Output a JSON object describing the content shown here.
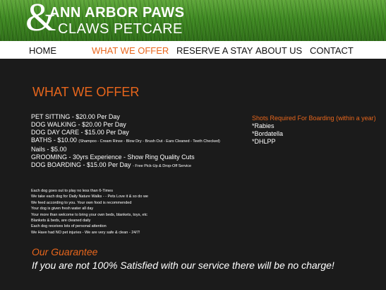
{
  "brand": {
    "ampersand": "&",
    "line1": "ANN ARBOR PAWS",
    "line2": "CLAWS PETCARE"
  },
  "nav": {
    "home": "HOME",
    "what_we_offer": "WHAT WE OFFER",
    "reserve": "RESERVE A STAY",
    "about": "ABOUT US",
    "contact": "CONTACT"
  },
  "page_title": "WHAT WE OFFER",
  "services": {
    "pet_sitting": "PET SITTING - $20.00 Per Day",
    "dog_walking": "DOG WALKING - $20.00 Per Day",
    "dog_day_care": "DOG DAY CARE - $15.00 Per Day",
    "baths": "BATHS - $10.00",
    "baths_note": "(Shampoo - Cream Rinse - Blow Dry - Brush Out - Ears Cleaned - Teeth Checked)",
    "nails": "Nails - $5.00",
    "grooming": "GROOMING - 30yrs Experience - Show Ring Quality Cuts",
    "dog_boarding": "DOG BOARDING - $15.00 Per Day",
    "dog_boarding_note": "- Free Pick-Up & Drop-Off Service"
  },
  "shots": {
    "title": "Shots Required For Boarding (within a year)",
    "items": [
      "*Rabies",
      "*Bordatella",
      "*DHLPP"
    ]
  },
  "policies": [
    "Each dog goes out to play no less than 6-Times",
    "We take each dog for Daily Nature Walks - - Pets Love it & so do we",
    "We feed according to you. Your own food is recommended",
    "Your dog is given fresh water all day",
    "Your more than welcome to bring your own beds, blankets, toys, etc",
    "Blankets & beds, are cleaned daily",
    "Each dog receives lots of  personal attention",
    "We Have had NO pet injuries - We are very safe & clean - 24/7!"
  ],
  "guarantee": {
    "title": "Our Guarantee",
    "text": "If you are not 100% Satisfied with our service there will be no charge!"
  },
  "colors": {
    "accent": "#e8661c",
    "background": "#1b1b1b",
    "nav_background": "#ffffff",
    "header_green": "#3f8a22"
  }
}
